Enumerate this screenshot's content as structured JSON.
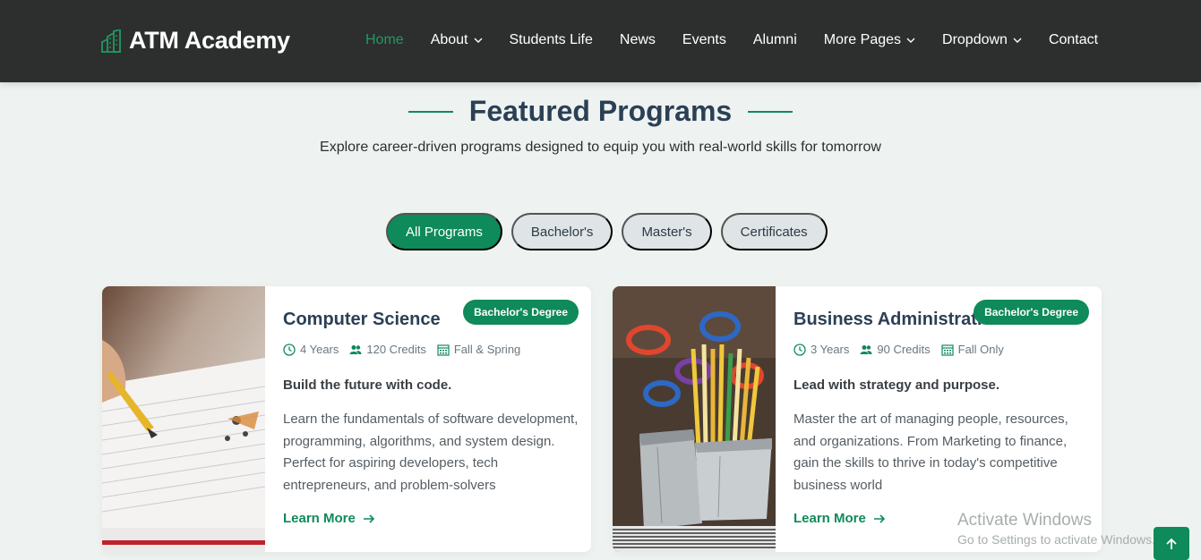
{
  "brand": {
    "name": "ATM Academy",
    "icon": "building-icon",
    "accent": "#0f8a5a"
  },
  "nav": {
    "items": [
      {
        "label": "Home",
        "active": true,
        "dropdown": false
      },
      {
        "label": "About",
        "active": false,
        "dropdown": true
      },
      {
        "label": "Students Life",
        "active": false,
        "dropdown": false
      },
      {
        "label": "News",
        "active": false,
        "dropdown": false
      },
      {
        "label": "Events",
        "active": false,
        "dropdown": false
      },
      {
        "label": "Alumni",
        "active": false,
        "dropdown": false
      },
      {
        "label": "More Pages",
        "active": false,
        "dropdown": true
      },
      {
        "label": "Dropdown",
        "active": false,
        "dropdown": true
      },
      {
        "label": "Contact",
        "active": false,
        "dropdown": false
      }
    ]
  },
  "section": {
    "title": "Featured Programs",
    "subtitle": "Explore career-driven programs designed to equip you with real-world skills for tomorrow"
  },
  "filters": [
    {
      "label": "All Programs",
      "active": true
    },
    {
      "label": "Bachelor's",
      "active": false
    },
    {
      "label": "Master's",
      "active": false
    },
    {
      "label": "Certificates",
      "active": false
    }
  ],
  "cards": [
    {
      "badge": "Bachelor's Degree",
      "title": "Computer Science",
      "meta": {
        "duration": "4 Years",
        "credits": "120 Credits",
        "intake": "Fall & Spring"
      },
      "tagline": "Build the future with code.",
      "description": "Learn the fundamentals of software development, programming, algorithms, and system design. Perfect for aspiring developers, tech entrepreneurs, and problem-solvers",
      "link": "Learn More"
    },
    {
      "badge": "Bachelor's Degree",
      "title": "Business Administration",
      "meta": {
        "duration": "3 Years",
        "credits": "90 Credits",
        "intake": "Fall Only"
      },
      "tagline": "Lead with strategy and purpose.",
      "description": "Master the art of managing people, resources, and organizations. From Marketing to finance, gain the skills to thrive in today's competitive business world",
      "link": "Learn More"
    }
  ],
  "watermark": {
    "line1": "Activate Windows",
    "line2": "Go to Settings to activate Windows."
  },
  "icons": {
    "clock": "clock-icon",
    "people": "people-icon",
    "calendar": "calendar-icon",
    "arrow": "arrow-right-icon",
    "scroll_top": "arrow-up-icon"
  }
}
